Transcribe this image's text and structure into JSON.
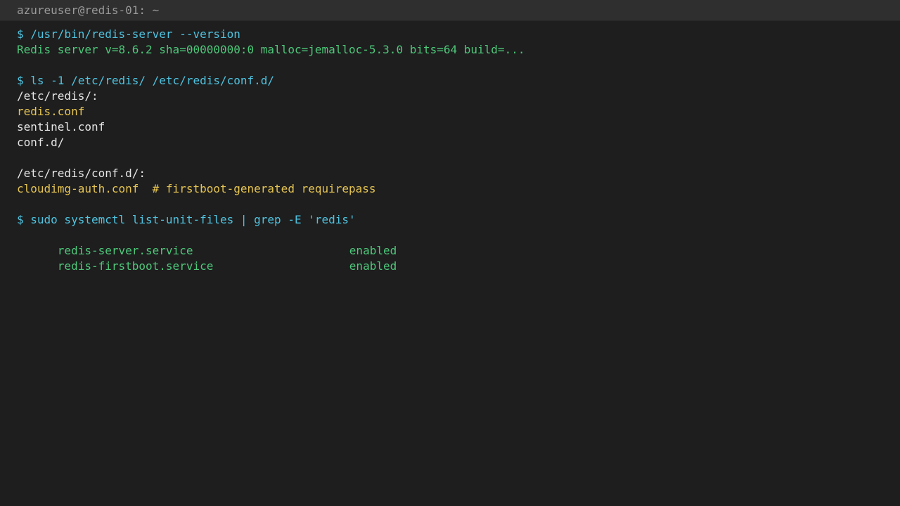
{
  "window": {
    "title": "azureuser@redis-01: ~"
  },
  "terminal": {
    "lines": [
      "$ /usr/bin/redis-server --version",
      "Redis server v=8.6.2 sha=00000000:0 malloc=jemalloc-5.3.0 bits=64 build=...",
      "",
      "$ ls -1 /etc/redis/ /etc/redis/conf.d/",
      "/etc/redis/:",
      "redis.conf",
      "sentinel.conf",
      "conf.d/",
      "",
      "/etc/redis/conf.d/:",
      "cloudimg-auth.conf  # firstboot-generated requirepass",
      "",
      "$ sudo systemctl list-unit-files | grep -E 'redis'",
      "redis-server.service",
      "enabled",
      "redis-firstboot.service",
      "enabled"
    ]
  },
  "colors": {
    "background": "#1e1e1e",
    "command": "#4fc3e0",
    "success": "#4ec77a",
    "highlight": "#e5c453",
    "text": "#e6e6e6"
  }
}
